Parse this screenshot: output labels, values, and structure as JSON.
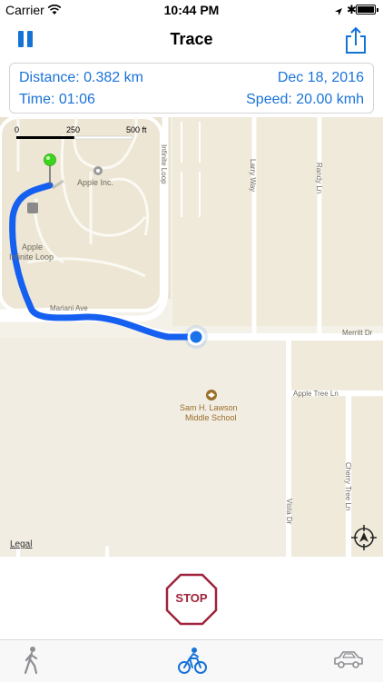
{
  "status_bar": {
    "carrier": "Carrier",
    "time": "10:44 PM",
    "bluetooth": "✱"
  },
  "nav": {
    "title": "Trace",
    "left_icon": "pause-icon",
    "right_icon": "share-icon"
  },
  "info": {
    "distance": "Distance: 0.382 km",
    "date": "Dec 18, 2016",
    "time": "Time: 01:06",
    "speed": "Speed: 20.00 kmh"
  },
  "map": {
    "scale": {
      "zero": "0",
      "mid": "250",
      "end": "500 ft"
    },
    "labels": {
      "apple_inc": "Apple Inc.",
      "apple_loop_1": "Apple",
      "apple_loop_2": "Infinite Loop",
      "mariani": "Mariani Ave",
      "merritt": "Merritt Dr",
      "apple_tree": "Apple Tree Ln",
      "school_1": "Sam H. Lawson",
      "school_2": "Middle School",
      "infinite_loop": "Infinite Loop",
      "larry": "Larry Way",
      "randy": "Randy Ln",
      "vista": "Vista Dr",
      "cherry": "Cherry Tree Ln"
    },
    "legal": "Legal",
    "route_color": "#1560f0",
    "start_pin_color": "#3dd41d",
    "current_location_color": "#1a73e8"
  },
  "stop": {
    "label": "STOP",
    "color": "#a0223c"
  },
  "tabs": [
    {
      "name": "walk",
      "icon": "pedestrian-icon",
      "selected": false
    },
    {
      "name": "bike",
      "icon": "bicycle-icon",
      "selected": true
    },
    {
      "name": "car",
      "icon": "car-icon",
      "selected": false
    }
  ],
  "colors": {
    "accent": "#1673d6",
    "inactive_tab": "#8e8e93"
  }
}
